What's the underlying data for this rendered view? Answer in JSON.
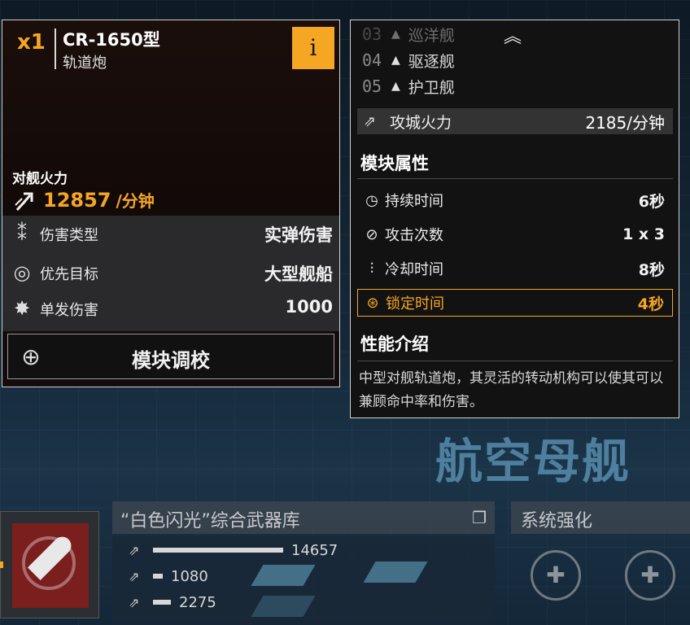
{
  "weapon": {
    "quantity": "x1",
    "name": "CR-1650型",
    "type": "轨道炮",
    "info_label": "i",
    "firepower_label": "对舰火力",
    "firepower_value": "12857",
    "firepower_unit": "/分钟",
    "stats": [
      {
        "icon": "ammo-icon",
        "label": "伤害类型",
        "value": "实弹伤害"
      },
      {
        "icon": "target-icon",
        "label": "优先目标",
        "value": "大型舰船"
      },
      {
        "icon": "burst-icon",
        "label": "单发伤害",
        "value": "1000"
      }
    ],
    "calibrate_label": "模块调校"
  },
  "detail": {
    "ship_classes": [
      {
        "num": "03",
        "label": "巡洋舰"
      },
      {
        "num": "04",
        "label": "驱逐舰"
      },
      {
        "num": "05",
        "label": "护卫舰"
      }
    ],
    "siege": {
      "label": "攻城火力",
      "value": "2185/分钟"
    },
    "attributes_title": "模块属性",
    "attributes": [
      {
        "icon": "clock-icon",
        "label": "持续时间",
        "value": "6秒"
      },
      {
        "icon": "strike-icon",
        "label": "攻击次数",
        "value": "1 x 3"
      },
      {
        "icon": "cooldown-icon",
        "label": "冷却时间",
        "value": "8秒"
      },
      {
        "icon": "lock-icon",
        "label": "锁定时间",
        "value": "4秒"
      }
    ],
    "intro_title": "性能介绍",
    "intro_text": "中型对舰轨道炮，其灵活的转动机构可以使其可以兼顾命中率和伤害。"
  },
  "background": {
    "watermark": "航空母舰"
  },
  "armory": {
    "title": "“白色闪光”综合武器库",
    "bars": [
      {
        "value": "14657"
      },
      {
        "value": "1080"
      },
      {
        "value": "2275"
      }
    ],
    "system_title": "系统强化"
  },
  "colors": {
    "accent": "#f5a623",
    "panel": "#121212"
  }
}
